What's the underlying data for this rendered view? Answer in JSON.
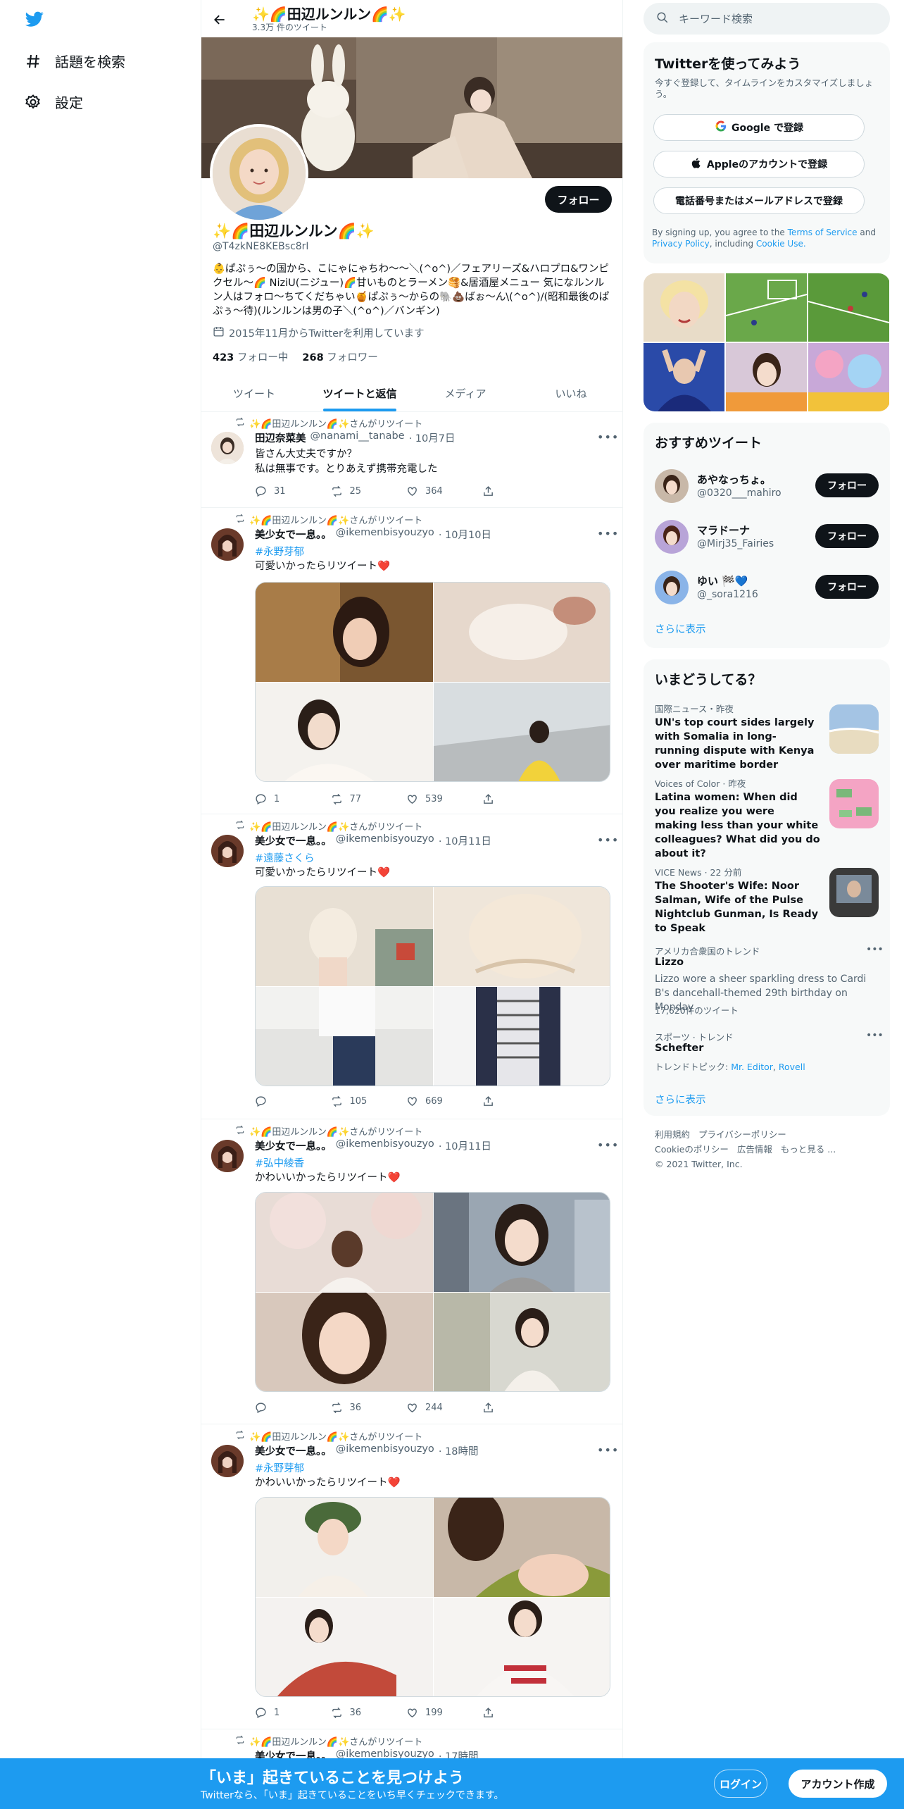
{
  "nav": {
    "explore_label": "話題を検索",
    "settings_label": "設定"
  },
  "header": {
    "title": "✨🌈田辺ルンルン🌈✨",
    "tweet_count": "3.3万 件のツイート"
  },
  "profile": {
    "follow_label": "フォロー",
    "name": "✨🌈田辺ルンルン🌈✨",
    "handle": "@T4zkNE8KEBsc8rI",
    "bio": "👶ぱぷぅ〜の国から、こにゃにゃちわ〜〜＼(^o^)／フェアリーズ&ハロプロ&ワンピクセル〜🌈 NiziU(ニジュー)🌈甘いものとラーメン🥞&居酒屋メニュー 気になルンルン人はフォロ〜ちてくだちゃい🍯ぱぷぅ〜からの🐘💩ばぉ〜ん\\(^o^)/(昭和最後のぱぷぅ〜待)(ルンルンは男の子＼(^o^)／バンギン)",
    "joined": "2015年11月からTwitterを利用しています",
    "following_count": "423",
    "following_label": "フォロー中",
    "followers_count": "268",
    "followers_label": "フォロワー"
  },
  "tabs": [
    "ツイート",
    "ツイートと返信",
    "メディア",
    "いいね"
  ],
  "tweets": [
    {
      "retweet_label": "✨🌈田辺ルンルン🌈✨さんがリツイート",
      "name": "田辺奈菜美",
      "handle": "@nanami__tanabe",
      "time": "· 10月7日",
      "hashtag": "",
      "text": "皆さん大丈夫ですか？\n私は無事です。とりあえず携帯充電した",
      "replies": "31",
      "retweets": "25",
      "likes": "364"
    },
    {
      "retweet_label": "✨🌈田辺ルンルン🌈✨さんがリツイート",
      "name": "美少女で一息。。",
      "handle": "@ikemenbisyouzyo",
      "time": "· 10月10日",
      "hashtag": "#永野芽郁",
      "text": "可愛いかったらリツイート❤️",
      "replies": "1",
      "retweets": "77",
      "likes": "539"
    },
    {
      "retweet_label": "✨🌈田辺ルンルン🌈✨さんがリツイート",
      "name": "美少女で一息。。",
      "handle": "@ikemenbisyouzyo",
      "time": "· 10月11日",
      "hashtag": "#遠藤さくら",
      "text": "可愛いかったらリツイート❤️",
      "replies": "",
      "retweets": "105",
      "likes": "669"
    },
    {
      "retweet_label": "✨🌈田辺ルンルン🌈✨さんがリツイート",
      "name": "美少女で一息。。",
      "handle": "@ikemenbisyouzyo",
      "time": "· 10月11日",
      "hashtag": "#弘中綾香",
      "text": "かわいいかったらリツイート❤️",
      "replies": "",
      "retweets": "36",
      "likes": "244"
    },
    {
      "retweet_label": "✨🌈田辺ルンルン🌈✨さんがリツイート",
      "name": "美少女で一息。。",
      "handle": "@ikemenbisyouzyo",
      "time": "· 18時間",
      "hashtag": "#永野芽郁",
      "text": "かわいいかったらリツイート❤️",
      "replies": "1",
      "retweets": "36",
      "likes": "199"
    },
    {
      "retweet_label": "✨🌈田辺ルンルン🌈✨さんがリツイート",
      "name": "美少女で一息。。",
      "handle": "@ikemenbisyouzyo",
      "time": "· 17時間"
    }
  ],
  "sidebar": {
    "search_placeholder": "キーワード検索",
    "signup": {
      "title": "Twitterを使ってみよう",
      "subtitle": "今すぐ登録して、タイムラインをカスタマイズしましょう。",
      "google": "Google で登録",
      "apple": "Appleのアカウントで登録",
      "phone": "電話番号またはメールアドレスで登録",
      "terms_prefix": "By signing up, you agree to the",
      "terms_link": "Terms of Service",
      "terms_and": "and",
      "privacy_link": "Privacy Policy",
      "terms_including": ", including",
      "cookie_link": "Cookie Use."
    },
    "recommend": {
      "title": "おすすめツイート",
      "users": [
        {
          "name": "あやなっちょ。",
          "handle": "@0320___mahiro",
          "button": "フォロー"
        },
        {
          "name": "マラドーナ",
          "handle": "@Mirj35_Fairies",
          "button": "フォロー"
        },
        {
          "name": "ゆい 🏁💙",
          "handle": "@_sora1216",
          "button": "フォロー"
        }
      ],
      "show_more": "さらに表示"
    },
    "trends": {
      "title": "いまどうしてる？",
      "items": [
        {
          "meta": "国際ニュース・昨夜",
          "headline": "UN's top court sides largely with Somalia in long-running dispute with Kenya over maritime border"
        },
        {
          "meta": "Voices of Color · 昨夜",
          "headline": "Latina women: When did you realize you were making less than your white colleagues? What did you do about it?"
        },
        {
          "meta": "VICE News · 22 分前",
          "headline": "The Shooter's Wife: Noor Salman, Wife of the Pulse Nightclub Gunman, Is Ready to Speak"
        }
      ],
      "lizzo": {
        "meta": "アメリカ合衆国のトレンド",
        "name": "Lizzo",
        "desc": "Lizzo wore a sheer sparkling dress to Cardi B's dancehall-themed 29th birthday on Monday",
        "count": "17,620件のツイート"
      },
      "schefter": {
        "meta": "スポーツ · トレンド",
        "name": "Schefter",
        "topic_prefix": "トレンドトピック:",
        "topic_1": "Mr. Editor",
        "topic_2": "Rovell"
      },
      "show_more": "さらに表示"
    },
    "footer": {
      "terms": "利用規約",
      "privacy": "プライバシーポリシー",
      "cookie": "Cookieのポリシー",
      "ads": "広告情報",
      "more": "もっと見る ...",
      "copyright": "© 2021 Twitter, Inc."
    }
  },
  "bottom_bar": {
    "title": "「いま」起きていることを見つけよう",
    "subtitle": "Twitterなら、「いま」起きていることをいち早くチェックできます。",
    "login": "ログイン",
    "signup": "アカウント作成"
  },
  "colors": {
    "accent": "#1d9bf0",
    "text": "#0f1419",
    "muted": "#536471",
    "panel": "#f7f9f9",
    "like_heart": "#e0245e"
  }
}
